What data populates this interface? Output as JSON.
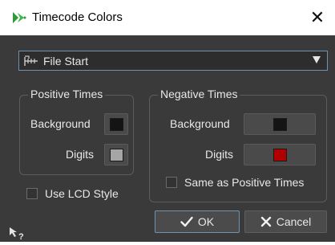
{
  "window": {
    "title": "Timecode Colors",
    "close_glyph": "✕",
    "app_icon": "wavelab-arrow-icon"
  },
  "dropdown": {
    "selected": "File Start",
    "icon": "file-start-icon"
  },
  "positive": {
    "title": "Positive Times",
    "background_label": "Background",
    "background_color": "#141414",
    "digits_label": "Digits",
    "digits_color": "#a6a6a6"
  },
  "negative": {
    "title": "Negative Times",
    "background_label": "Background",
    "background_color": "#141414",
    "digits_label": "Digits",
    "digits_color": "#b00000",
    "same_as_positive_label": "Same as Positive Times",
    "same_as_positive_checked": false
  },
  "lcd": {
    "label": "Use LCD Style",
    "checked": false
  },
  "buttons": {
    "ok": "OK",
    "cancel": "Cancel"
  },
  "colors": {
    "accent_border": "#6f92b3",
    "dialog_bg": "#3a3a3a"
  }
}
